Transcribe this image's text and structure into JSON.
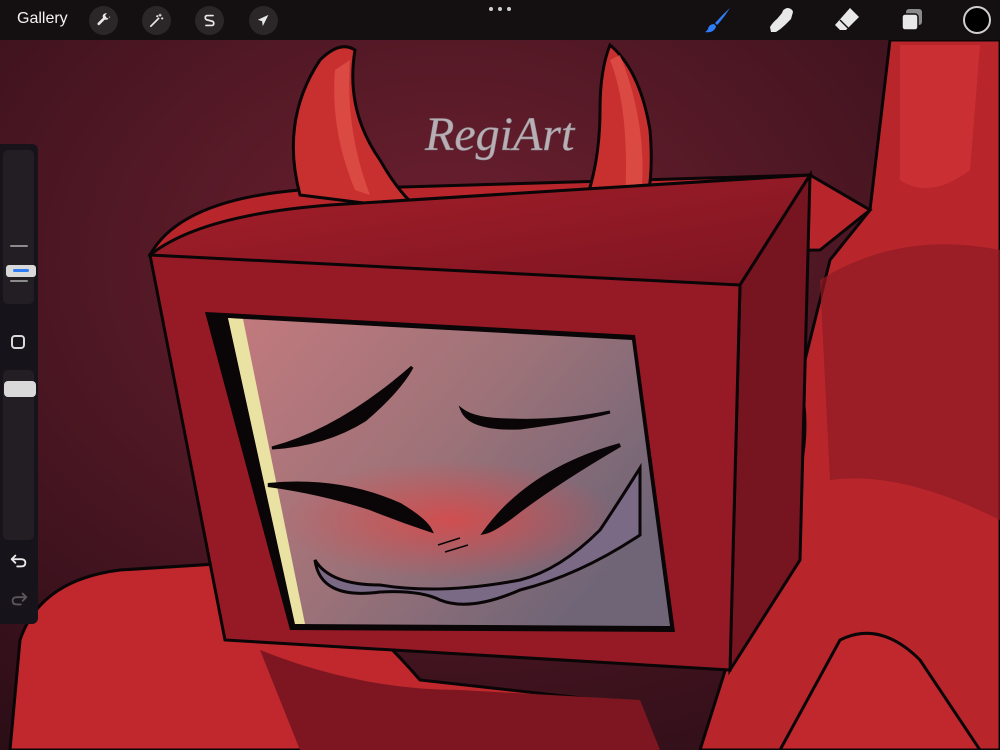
{
  "toolbar": {
    "gallery_label": "Gallery",
    "left_tools": [
      {
        "name": "actions",
        "icon": "wrench-icon"
      },
      {
        "name": "adjustments",
        "icon": "magic-wand-icon"
      },
      {
        "name": "selection",
        "icon": "selection-s-icon"
      },
      {
        "name": "transform",
        "icon": "arrow-cursor-icon"
      }
    ],
    "right_tools": [
      {
        "name": "brush",
        "icon": "brush-icon",
        "active": true
      },
      {
        "name": "smudge",
        "icon": "smudge-finger-icon"
      },
      {
        "name": "eraser",
        "icon": "eraser-icon"
      },
      {
        "name": "layers",
        "icon": "layers-icon"
      }
    ],
    "active_color": "#000000",
    "accent_color": "#2f7cf7"
  },
  "sidebar": {
    "brush_size_level": 0.8,
    "opacity_level": 1.0,
    "undo_icon": "undo-arrow-icon",
    "redo_icon": "redo-arrow-icon"
  },
  "artwork": {
    "signature": "RegiArt",
    "palette": {
      "background": "#3a1520",
      "body_red": "#c0282d",
      "body_shadow": "#7d1620",
      "horn_red": "#d8393a",
      "outline": "#0a0506"
    }
  }
}
